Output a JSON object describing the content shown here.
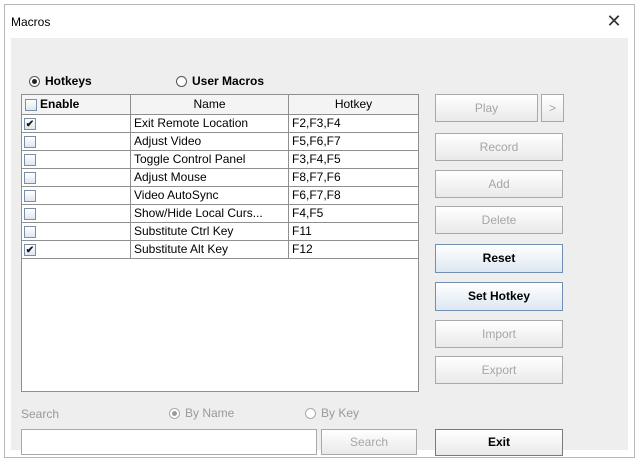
{
  "window": {
    "title": "Macros",
    "close_symbol": "✕"
  },
  "mode": {
    "options": [
      {
        "label": "Hotkeys",
        "selected": true
      },
      {
        "label": "User Macros",
        "selected": false
      }
    ]
  },
  "table": {
    "headers": [
      "Enable",
      "Name",
      "Hotkey"
    ],
    "rows": [
      {
        "enabled": "✔",
        "name": "Exit Remote Location",
        "hotkey": "F2,F3,F4"
      },
      {
        "enabled": "",
        "name": "Adjust Video",
        "hotkey": "F5,F6,F7"
      },
      {
        "enabled": "",
        "name": "Toggle Control Panel",
        "hotkey": "F3,F4,F5"
      },
      {
        "enabled": "",
        "name": "Adjust Mouse",
        "hotkey": "F8,F7,F6"
      },
      {
        "enabled": "",
        "name": "Video AutoSync",
        "hotkey": "F6,F7,F8"
      },
      {
        "enabled": "",
        "name": "Show/Hide Local Curs...",
        "hotkey": "F4,F5"
      },
      {
        "enabled": "",
        "name": "Substitute Ctrl Key",
        "hotkey": "F11"
      },
      {
        "enabled": "✔",
        "name": "Substitute Alt Key",
        "hotkey": "F12"
      }
    ]
  },
  "buttons": {
    "play": "Play",
    "play_more": ">",
    "record": "Record",
    "add": "Add",
    "delete": "Delete",
    "reset": "Reset",
    "set_hotkey": "Set Hotkey",
    "import": "Import",
    "export": "Export",
    "exit": "Exit"
  },
  "search": {
    "label": "Search",
    "by_name": "By Name",
    "by_key": "By Key",
    "value": "",
    "button": "Search"
  }
}
